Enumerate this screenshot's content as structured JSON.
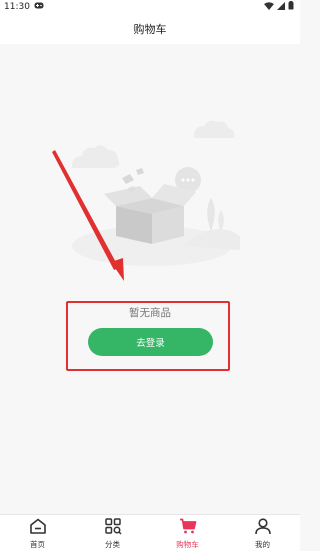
{
  "status_bar": {
    "time": "11:30"
  },
  "header": {
    "title": "购物车"
  },
  "empty_state": {
    "message": "暂无商品",
    "login_button": "去登录"
  },
  "tabs": [
    {
      "label": "首页",
      "icon": "home-icon",
      "active": false
    },
    {
      "label": "分类",
      "icon": "category-search-icon",
      "active": false
    },
    {
      "label": "购物车",
      "icon": "cart-icon",
      "active": true
    },
    {
      "label": "我的",
      "icon": "user-icon",
      "active": false
    }
  ],
  "colors": {
    "accent_green": "#35b566",
    "active_tab": "#e8365a",
    "annotation_red": "#e03030"
  }
}
